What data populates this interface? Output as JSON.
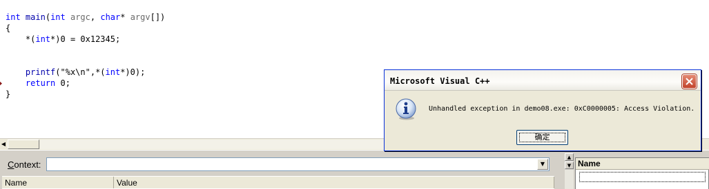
{
  "editor": {
    "code_lines": [
      [
        {
          "t": "int",
          "c": "kw"
        },
        {
          "t": " ",
          "c": "id"
        },
        {
          "t": "main",
          "c": "fn"
        },
        {
          "t": "(",
          "c": "id"
        },
        {
          "t": "int",
          "c": "kw"
        },
        {
          "t": " ",
          "c": "id"
        },
        {
          "t": "argc",
          "c": "prm"
        },
        {
          "t": ", ",
          "c": "id"
        },
        {
          "t": "char",
          "c": "kw"
        },
        {
          "t": "* ",
          "c": "id"
        },
        {
          "t": "argv",
          "c": "prm"
        },
        {
          "t": "[])",
          "c": "id"
        }
      ],
      [
        {
          "t": "{",
          "c": "id"
        }
      ],
      [
        {
          "t": "    *(",
          "c": "id"
        },
        {
          "t": "int",
          "c": "kw"
        },
        {
          "t": "*)0 = 0x12345;",
          "c": "id"
        }
      ],
      [],
      [],
      [
        {
          "t": "    ",
          "c": "id"
        },
        {
          "t": "printf",
          "c": "fn"
        },
        {
          "t": "(\"%x\\n\",*(",
          "c": "str"
        },
        {
          "t": "int",
          "c": "kw"
        },
        {
          "t": "*)0);",
          "c": "id"
        }
      ],
      [
        {
          "t": "    ",
          "c": "id"
        },
        {
          "t": "return",
          "c": "kw"
        },
        {
          "t": " 0;",
          "c": "id"
        }
      ],
      [
        {
          "t": "}",
          "c": "id"
        }
      ]
    ],
    "breakpoint_line": 7,
    "breakpoint_color": "#8b1a1a"
  },
  "context_pane": {
    "label_prefix": "C",
    "label_rest": "ontext:",
    "combo_value": "",
    "columns": [
      "Name",
      "Value"
    ]
  },
  "watch_pane": {
    "columns": [
      "Name"
    ]
  },
  "msgbox": {
    "title": "Microsoft Visual C++",
    "message": "Unhandled exception in demo08.exe: 0xC0000005: Access Violation.",
    "ok_label": "确定",
    "icon": "info-icon",
    "close_color": "#c2432a",
    "border_color": "#0831d9"
  }
}
